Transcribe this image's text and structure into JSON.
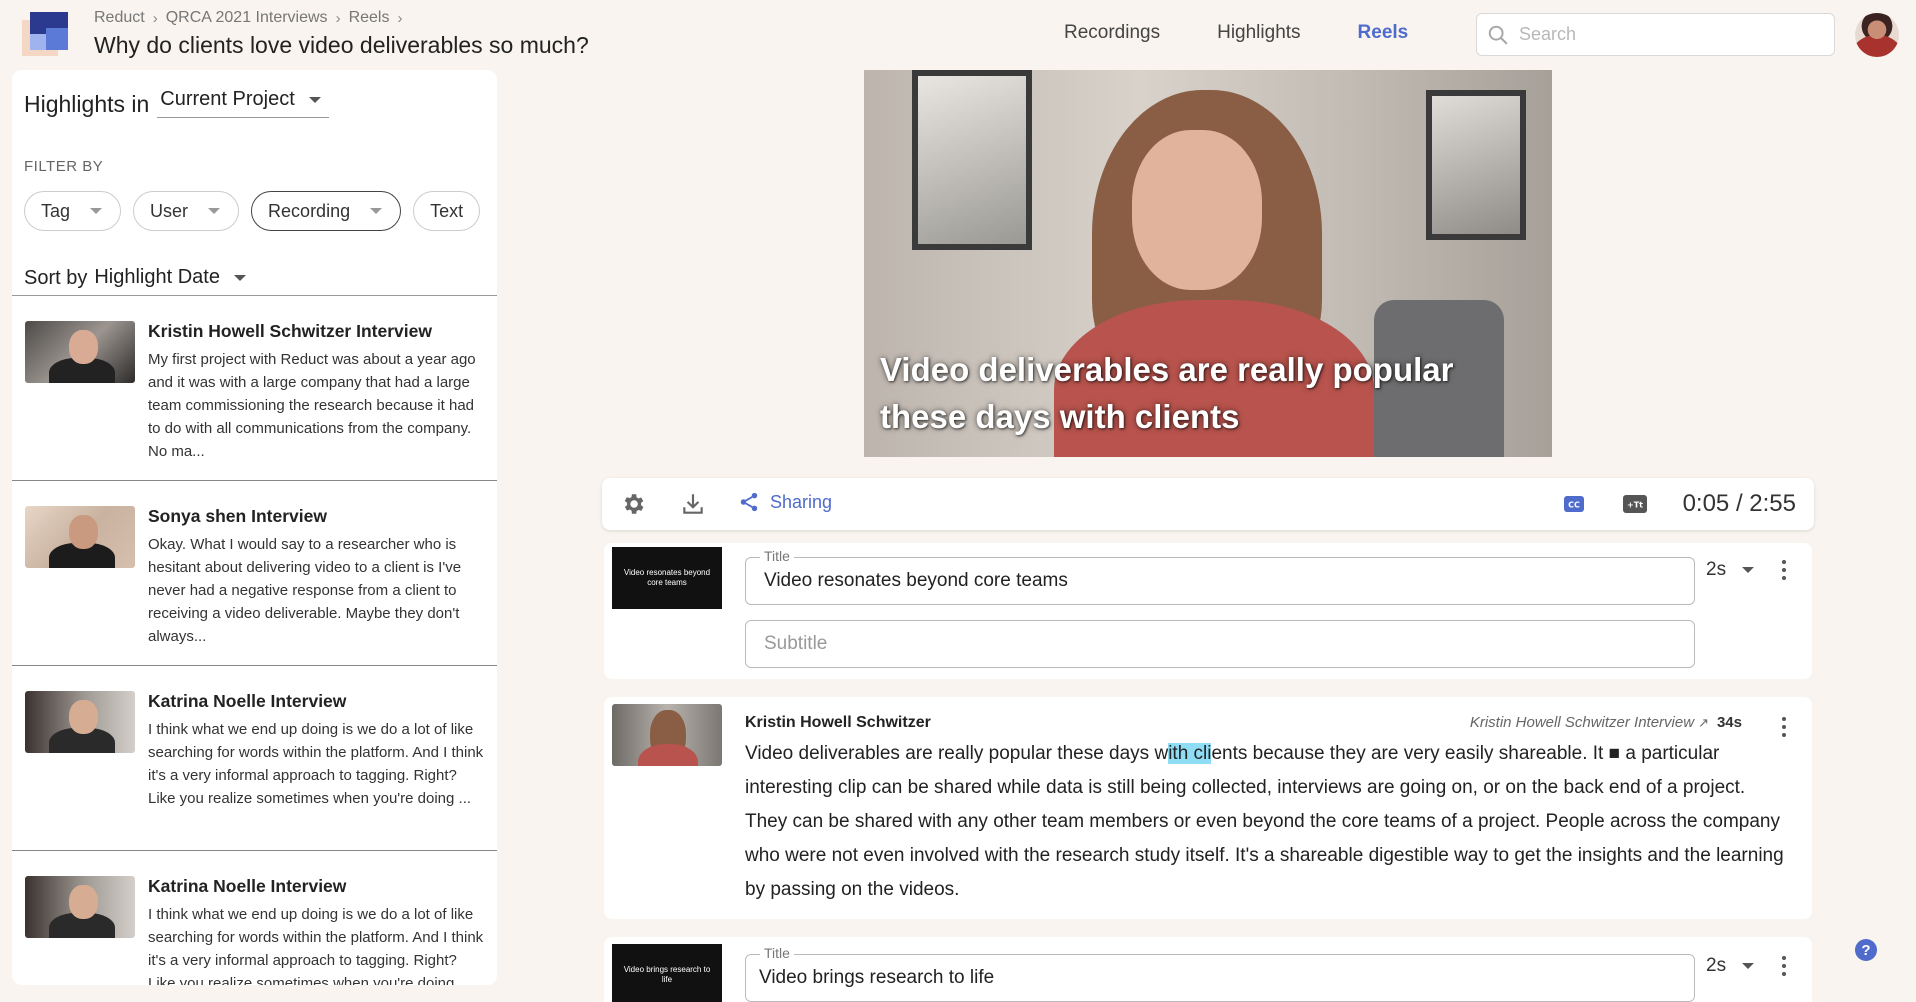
{
  "header": {
    "breadcrumb": [
      "Reduct",
      "QRCA 2021 Interviews",
      "Reels"
    ],
    "page_title": "Why do clients love video deliverables so much?",
    "nav": [
      {
        "label": "Recordings",
        "active": false
      },
      {
        "label": "Highlights",
        "active": false
      },
      {
        "label": "Reels",
        "active": true
      }
    ],
    "search_placeholder": "Search"
  },
  "left_panel": {
    "highlights_in_label": "Highlights in",
    "scope": "Current Project",
    "filter_by_label": "FILTER BY",
    "filters": [
      "Tag",
      "User",
      "Recording",
      "Text"
    ],
    "sort_by_label": "Sort by",
    "sort_value": "Highlight Date",
    "items": [
      {
        "name": "Kristin Howell Schwitzer Interview",
        "excerpt": "My first project with Reduct was about a year ago and it was with a large company that had a large team commissioning the research because it had to do with all communications from the company. No ma..."
      },
      {
        "name": "Sonya shen Interview",
        "excerpt": "Okay. What I would say to a researcher who is hesitant about delivering video to a client is I've never had a negative response from a client to receiving a video deliverable. Maybe they don't always..."
      },
      {
        "name": "Katrina Noelle Interview",
        "excerpt": "I think what we end up doing is we do a lot of like searching for words within the platform. And I think it's a very informal approach to tagging. Right? Like you realize sometimes when you're doing ..."
      },
      {
        "name": "Katrina Noelle Interview",
        "excerpt": "I think what we end up doing is we do a lot of like searching for words within the platform. And I think it's a very informal approach to tagging. Right? Like you realize sometimes when you're doing ..."
      }
    ]
  },
  "player": {
    "caption": "Video deliverables are really popular these days with clients",
    "sharing_label": "Sharing",
    "cc_label": "CC",
    "text_label": "+Tt",
    "timecode": "0:05 / 2:55"
  },
  "clips": {
    "title_card_1": {
      "thumb_text": "Video resonates beyond core teams",
      "title_legend": "Title",
      "title": "Video resonates beyond core teams",
      "subtitle_placeholder": "Subtitle",
      "duration": "2s"
    },
    "transcript_card": {
      "speaker": "Kristin Howell Schwitzer",
      "source": "Kristin Howell Schwitzer Interview",
      "length": "34s",
      "text_before": "Video deliverables are really popular these days w",
      "text_highlight": "ith cli",
      "text_after": "ents because they are very easily shareable. It ■ a particular interesting clip can be shared while data is still being collected, interviews are going on, or on the back end of a project. They can be shared with any other team members or even beyond the core teams of a project. People across the company who were not even involved with the research study itself. It's a shareable digestible way to get the insights and the learning by passing on the videos."
    },
    "title_card_2": {
      "thumb_text": "Video brings research to life",
      "title_legend": "Title",
      "title": "Video brings research to life",
      "duration": "2s"
    }
  },
  "help_label": "?",
  "colors": {
    "accent": "#4f6bcc",
    "highlight": "#8fdcf5",
    "background": "#f9f4ef"
  }
}
